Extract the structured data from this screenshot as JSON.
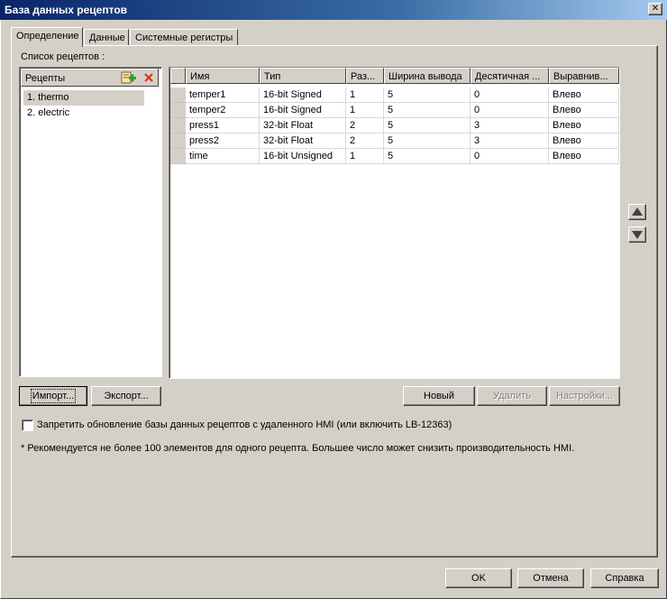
{
  "window": {
    "title": "База данных рецептов",
    "close_glyph": "✕"
  },
  "tabs": [
    {
      "label": "Определение",
      "active": true
    },
    {
      "label": "Данные",
      "active": false
    },
    {
      "label": "Системные регистры",
      "active": false
    }
  ],
  "recipe_list": {
    "section_label": "Список рецептов :",
    "header": "Рецепты",
    "add_icon": "add-recipe-icon",
    "delete_icon": "delete-recipe-icon",
    "items": [
      {
        "label": "1. thermo",
        "selected": true
      },
      {
        "label": "2. electric",
        "selected": false
      }
    ]
  },
  "grid": {
    "columns": [
      "Имя",
      "Тип",
      "Раз...",
      "Ширина вывода",
      "Десятичная ...",
      "Выравнив..."
    ],
    "rows": [
      [
        "temper1",
        "16-bit Signed",
        "1",
        "5",
        "0",
        "Влево"
      ],
      [
        "temper2",
        "16-bit Signed",
        "1",
        "5",
        "0",
        "Влево"
      ],
      [
        "press1",
        "32-bit Float",
        "2",
        "5",
        "3",
        "Влево"
      ],
      [
        "press2",
        "32-bit Float",
        "2",
        "5",
        "3",
        "Влево"
      ],
      [
        "time",
        "16-bit Unsigned",
        "1",
        "5",
        "0",
        "Влево"
      ]
    ]
  },
  "buttons": {
    "import": "Импорт...",
    "export": "Экспорт...",
    "new": "Новый",
    "delete": "Удалить",
    "settings": "Настройки...",
    "ok": "OK",
    "cancel": "Отмена",
    "help": "Справка"
  },
  "options": {
    "prohibit_update_label": "Запретить обновление базы данных рецептов с удаленного HMI (или включить LB-12363)",
    "prohibit_update_checked": false
  },
  "note": "* Рекомендуется не более 100 элементов для одного рецепта. Большее число может снизить производительность HMI.",
  "colors": {
    "title_gradient_start": "#0a246a",
    "title_gradient_end": "#a6caf0",
    "dialog_face": "#d4d0c8",
    "selection": "#d4d0c8",
    "add_icon_green": "#2e9e2e",
    "delete_icon_red": "#e03020"
  }
}
